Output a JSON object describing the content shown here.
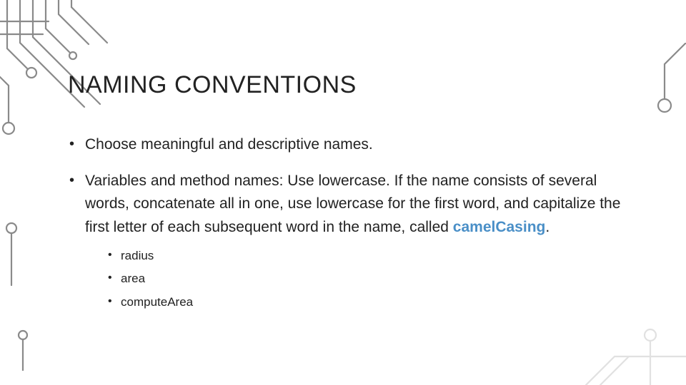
{
  "title": "NAMING CONVENTIONS",
  "bullets": {
    "0": {
      "text": "Choose meaningful and descriptive names."
    },
    "1": {
      "prefix": "Variables and method names: Use lowercase. If the name consists of several words, concatenate all in one, use lowercase for the first word, and capitalize the first letter of each subsequent word in the name, called ",
      "accent": "camelCasing",
      "suffix": "."
    }
  },
  "sub": {
    "0": "radius",
    "1": "area",
    "2": "computeArea"
  }
}
